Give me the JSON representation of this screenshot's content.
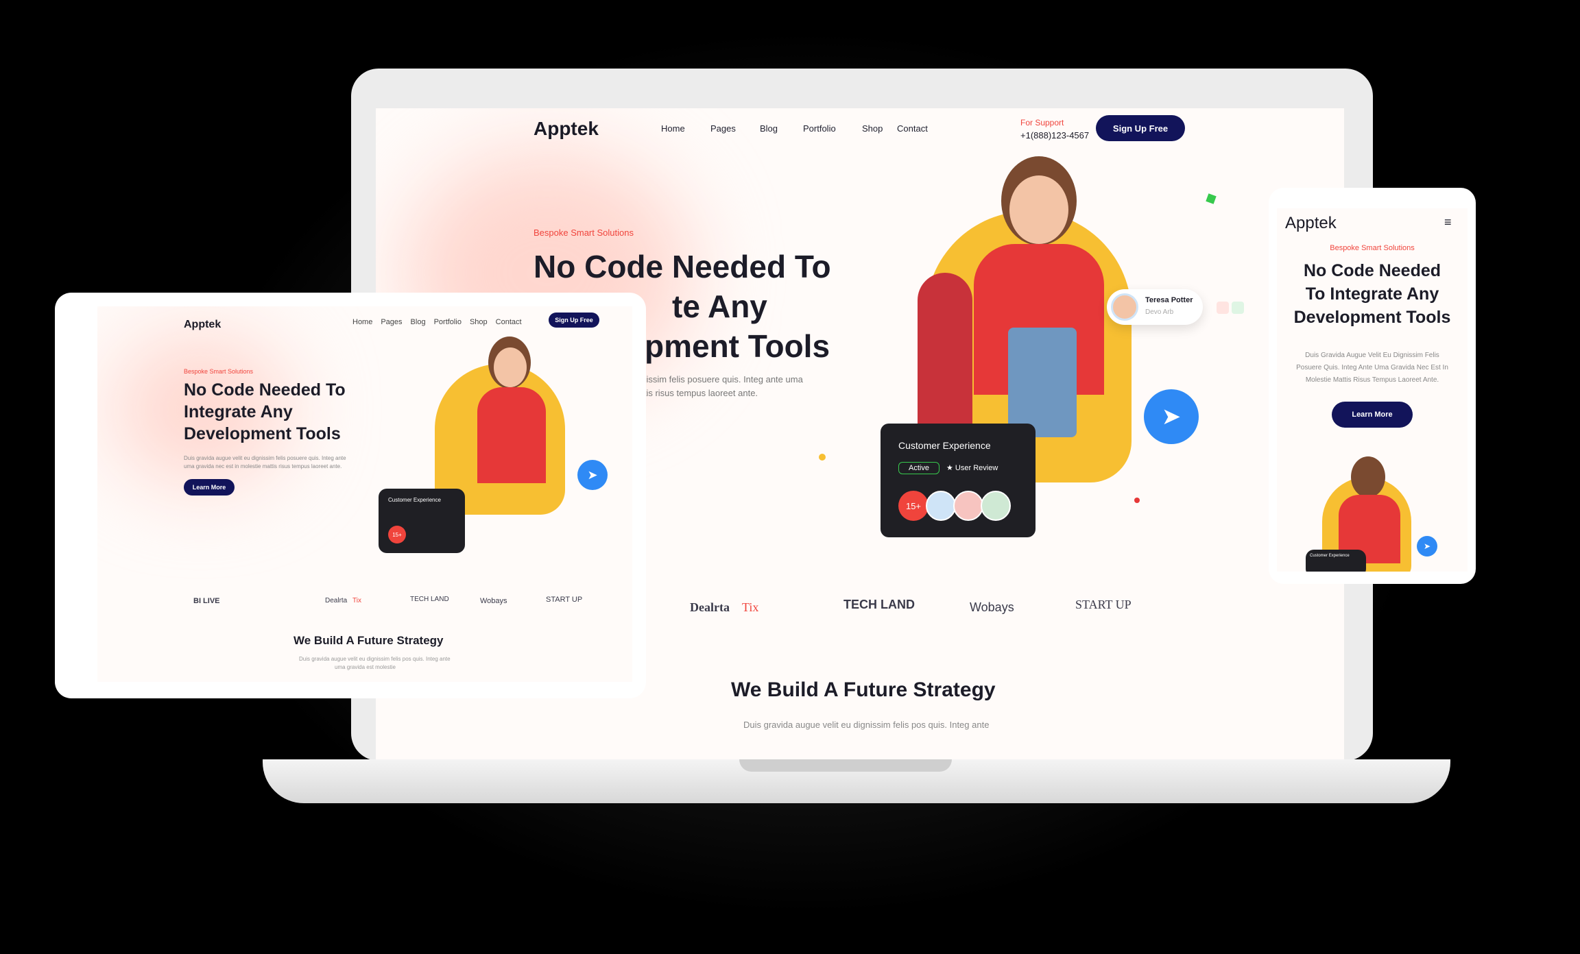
{
  "brand": "Apptek",
  "nav": {
    "items": [
      "Home",
      "Pages",
      "Blog",
      "Portfolio",
      "Shop",
      "Contact"
    ],
    "support_label": "For Support",
    "support_phone": "+1(888)123-4567",
    "cta": "Sign Up Free"
  },
  "hero": {
    "eyebrow": "Bespoke Smart Solutions",
    "title_line1": "No Code Needed To",
    "title_line2": "Integrate Any",
    "title_line3": "Development Tools",
    "laptop_line2_visible": "te Any",
    "laptop_line3_visible": "pment Tools",
    "laptop_body_line1": "gnissim felis posuere quis. Integ ante uma",
    "laptop_body_line2": "attis risus tempus laoreet ante.",
    "body": "Duis gravida augue velit eu dignissim felis posuere quis. Integ ante uma gravida nec est in molestie mattis risus tempus laoreet ante.",
    "button": "Learn More"
  },
  "profile_card": {
    "name": "Teresa Potter",
    "role": "Devo Arb"
  },
  "customer_card": {
    "title": "Customer Experience",
    "status": "Active",
    "review": "User Review",
    "count": "15+"
  },
  "logos": {
    "laptop": [
      "Dealrta",
      "Tix",
      "TECH LAND",
      "Wobays",
      "START UP"
    ],
    "tablet": [
      "BI LIVE",
      "Dealrta",
      "Tix",
      "TECH LAND",
      "Wobays",
      "START UP"
    ]
  },
  "strategy": {
    "title": "We Build A Future Strategy",
    "laptop_body": "Duis gravida augue velit eu dignissim felis pos quis. Integ ante",
    "tablet_body_line1": "Duis gravida augue velit eu dignissim felis pos quis. Integ ante",
    "tablet_body_line2": "uma gravida est molestie"
  },
  "phone": {
    "eyebrow": "Bespoke Smart Solutions",
    "title_line1": "No Code Needed",
    "title_line2": "To Integrate Any",
    "title_line3": "Development Tools",
    "body_line1": "Duis Gravida Augue Velit Eu Dignissim Felis",
    "body_line2": "Posuere Quis. Integ Ante Uma Gravida Nec Est In",
    "body_line3": "Molestie Mattis Risus Tempus Laoreet Ante.",
    "button": "Learn More",
    "mini_card": "Customer Experience"
  },
  "colors": {
    "brand_navy": "#12145a",
    "accent_red": "#f0443c",
    "accent_yellow": "#f7bf32",
    "send_blue": "#2f8af5"
  }
}
